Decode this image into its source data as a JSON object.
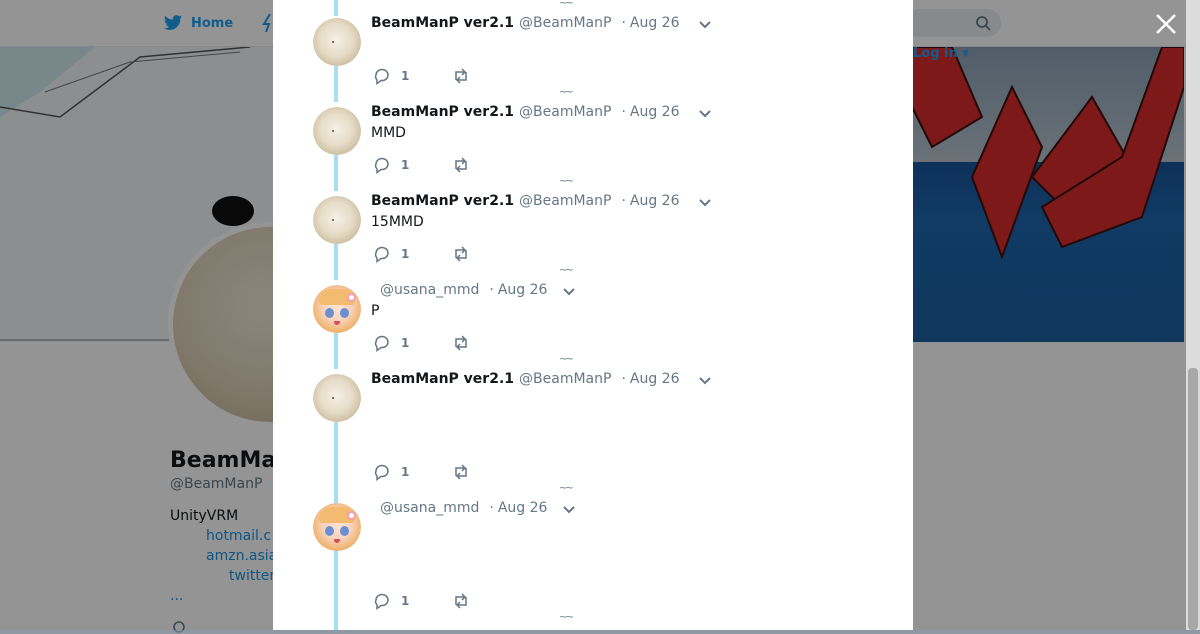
{
  "nav": {
    "home_label": "Home",
    "login_label": "Log in"
  },
  "profile": {
    "name": "BeamMa",
    "handle": "@BeamManP",
    "bio": "UnityVRM",
    "links": [
      "hotmail.c",
      "amzn.asia",
      "twitter"
    ],
    "more": "..."
  },
  "tweets": [
    {
      "name": "BeamManP ver2.1",
      "handle": "@BeamManP",
      "date": "Aug 26",
      "text": "",
      "reply_count": "1",
      "avatar": "plate-avatar"
    },
    {
      "name": "BeamManP ver2.1",
      "handle": "@BeamManP",
      "date": "Aug 26",
      "text": "MMD",
      "reply_count": "1",
      "avatar": "plate-avatar"
    },
    {
      "name": "BeamManP ver2.1",
      "handle": "@BeamManP",
      "date": "Aug 26",
      "text": "15MMD",
      "reply_count": "1",
      "avatar": "plate-avatar"
    },
    {
      "name": "",
      "handle": "@usana_mmd",
      "date": "Aug 26",
      "text": "P",
      "reply_count": "1",
      "avatar": "anime-avatar"
    },
    {
      "name": "BeamManP ver2.1",
      "handle": "@BeamManP",
      "date": "Aug 26",
      "text": "",
      "reply_count": "1",
      "avatar": "plate-avatar"
    },
    {
      "name": "",
      "handle": "@usana_mmd",
      "date": "Aug 26",
      "text": "",
      "reply_count": "1",
      "avatar": "anime-avatar"
    }
  ],
  "separator_glyph": "~~",
  "date_prefix": "·",
  "colors": {
    "brand": "#1da1f2",
    "thread_line": "#a9ddf6",
    "muted": "#657786"
  }
}
